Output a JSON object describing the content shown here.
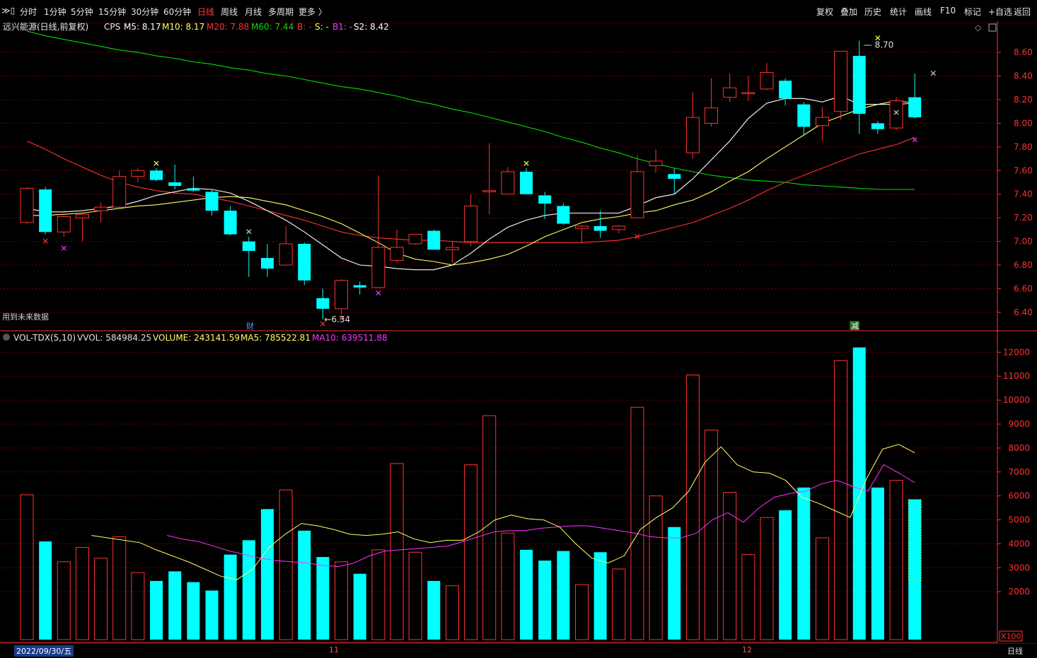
{
  "toolbar": {
    "left_items": [
      "分时",
      "1分钟",
      "5分钟",
      "15分钟",
      "30分钟",
      "60分钟",
      "日线",
      "周线",
      "月线",
      "多周期",
      "更多 〉"
    ],
    "active": "日线",
    "right_items": [
      "复权",
      "叠加",
      "历史",
      "统计",
      "画线",
      "F10",
      "标记",
      "+自选",
      "返回"
    ]
  },
  "colors": {
    "up": "#ff3232",
    "down": "#00ffff",
    "ma5": "#ffffff",
    "ma10": "#ffff66",
    "ma20": "#ff3030",
    "ma60": "#00e000",
    "vol_ma5": "#ffff66",
    "vol_ma10": "#ff33ff",
    "axis": "#ff3030",
    "grid": "#7a0000"
  },
  "main_panel": {
    "title": "远兴能源(日线,前复权)",
    "indicator": "CPS",
    "legend": [
      {
        "text": "M5: 8.17",
        "color": "#ffffff"
      },
      {
        "text": "M10: 8.17",
        "color": "#ffff66"
      },
      {
        "text": "M20: 7.88",
        "color": "#ff3030"
      },
      {
        "text": "M60: 7.44",
        "color": "#00e000"
      },
      {
        "text": "B: -",
        "color": "#ff3030"
      },
      {
        "text": "S: -",
        "color": "#ffff66"
      },
      {
        "text": "B1: -",
        "color": "#ff33ff"
      },
      {
        "text": "S2: 8.42",
        "color": "#ffffff"
      }
    ],
    "note": "用到未来数据",
    "high_label": "8.70",
    "low_label": "6.34",
    "event_markers": [
      "财",
      "减"
    ]
  },
  "vol_panel": {
    "title": "VOL-TDX(5,10)",
    "legend": [
      {
        "text": "VVOL: 584984.25",
        "color": "#e0e0e0"
      },
      {
        "text": "VOLUME: 243141.59",
        "color": "#ffff66"
      },
      {
        "text": "MA5: 785522.81",
        "color": "#ffff66"
      },
      {
        "text": "MA10: 639511.88",
        "color": "#ff33ff"
      }
    ],
    "unit": "X100"
  },
  "chart_data": {
    "type": "candlestick",
    "price_axis": {
      "ylim": [
        6.25,
        8.78
      ],
      "ticks": [
        6.4,
        6.6,
        6.8,
        7.0,
        7.2,
        7.4,
        7.6,
        7.8,
        8.0,
        8.2,
        8.4,
        8.6
      ]
    },
    "volume_axis": {
      "ylim": [
        0,
        12600
      ],
      "ticks": [
        2000,
        3000,
        4000,
        5000,
        6000,
        7000,
        8000,
        9000,
        10000,
        11000,
        12000
      ]
    },
    "x_labels": [
      "2022/09/30/五",
      "11",
      "12"
    ],
    "candles": [
      {
        "o": 7.16,
        "h": 7.46,
        "l": 7.15,
        "c": 7.45
      },
      {
        "o": 7.44,
        "h": 7.46,
        "l": 7.06,
        "c": 7.08
      },
      {
        "o": 7.08,
        "h": 7.22,
        "l": 7.04,
        "c": 7.21
      },
      {
        "o": 7.2,
        "h": 7.25,
        "l": 7.0,
        "c": 7.23
      },
      {
        "o": 7.26,
        "h": 7.33,
        "l": 7.16,
        "c": 7.29
      },
      {
        "o": 7.29,
        "h": 7.6,
        "l": 7.28,
        "c": 7.55
      },
      {
        "o": 7.55,
        "h": 7.62,
        "l": 7.5,
        "c": 7.6
      },
      {
        "o": 7.6,
        "h": 7.62,
        "l": 7.51,
        "c": 7.52
      },
      {
        "o": 7.5,
        "h": 7.65,
        "l": 7.44,
        "c": 7.47
      },
      {
        "o": 7.45,
        "h": 7.55,
        "l": 7.42,
        "c": 7.43
      },
      {
        "o": 7.42,
        "h": 7.44,
        "l": 7.22,
        "c": 7.26
      },
      {
        "o": 7.26,
        "h": 7.3,
        "l": 7.05,
        "c": 7.06
      },
      {
        "o": 7.0,
        "h": 7.04,
        "l": 6.7,
        "c": 6.92
      },
      {
        "o": 6.86,
        "h": 6.98,
        "l": 6.7,
        "c": 6.77
      },
      {
        "o": 6.8,
        "h": 7.13,
        "l": 6.8,
        "c": 6.98
      },
      {
        "o": 6.98,
        "h": 6.99,
        "l": 6.63,
        "c": 6.67
      },
      {
        "o": 6.52,
        "h": 6.6,
        "l": 6.34,
        "c": 6.43
      },
      {
        "o": 6.43,
        "h": 6.68,
        "l": 6.38,
        "c": 6.67
      },
      {
        "o": 6.63,
        "h": 6.66,
        "l": 6.55,
        "c": 6.61
      },
      {
        "o": 6.61,
        "h": 7.56,
        "l": 6.61,
        "c": 6.95
      },
      {
        "o": 6.84,
        "h": 7.1,
        "l": 6.82,
        "c": 6.95
      },
      {
        "o": 6.98,
        "h": 7.05,
        "l": 6.97,
        "c": 7.06
      },
      {
        "o": 7.09,
        "h": 7.1,
        "l": 6.93,
        "c": 6.93
      },
      {
        "o": 6.93,
        "h": 7.0,
        "l": 6.82,
        "c": 6.95
      },
      {
        "o": 7.0,
        "h": 7.4,
        "l": 6.96,
        "c": 7.3
      },
      {
        "o": 7.42,
        "h": 7.83,
        "l": 7.23,
        "c": 7.43
      },
      {
        "o": 7.4,
        "h": 7.63,
        "l": 7.4,
        "c": 7.59
      },
      {
        "o": 7.59,
        "h": 7.62,
        "l": 7.4,
        "c": 7.4
      },
      {
        "o": 7.39,
        "h": 7.42,
        "l": 7.19,
        "c": 7.32
      },
      {
        "o": 7.3,
        "h": 7.32,
        "l": 7.14,
        "c": 7.15
      },
      {
        "o": 7.11,
        "h": 7.14,
        "l": 6.99,
        "c": 7.13
      },
      {
        "o": 7.13,
        "h": 7.26,
        "l": 7.03,
        "c": 7.09
      },
      {
        "o": 7.1,
        "h": 7.14,
        "l": 7.07,
        "c": 7.13
      },
      {
        "o": 7.2,
        "h": 7.73,
        "l": 7.2,
        "c": 7.59
      },
      {
        "o": 7.64,
        "h": 7.78,
        "l": 7.58,
        "c": 7.68
      },
      {
        "o": 7.57,
        "h": 7.62,
        "l": 7.4,
        "c": 7.53
      },
      {
        "o": 7.75,
        "h": 8.26,
        "l": 7.7,
        "c": 8.05
      },
      {
        "o": 8.0,
        "h": 8.38,
        "l": 7.97,
        "c": 8.13
      },
      {
        "o": 8.22,
        "h": 8.42,
        "l": 8.18,
        "c": 8.3
      },
      {
        "o": 8.25,
        "h": 8.4,
        "l": 8.19,
        "c": 8.26
      },
      {
        "o": 8.29,
        "h": 8.51,
        "l": 8.28,
        "c": 8.43
      },
      {
        "o": 8.36,
        "h": 8.38,
        "l": 8.15,
        "c": 8.21
      },
      {
        "o": 8.16,
        "h": 8.18,
        "l": 7.9,
        "c": 7.97
      },
      {
        "o": 7.98,
        "h": 8.14,
        "l": 7.85,
        "c": 8.05
      },
      {
        "o": 8.1,
        "h": 8.61,
        "l": 8.03,
        "c": 8.61
      },
      {
        "o": 8.57,
        "h": 8.7,
        "l": 7.91,
        "c": 8.08
      },
      {
        "o": 8.0,
        "h": 8.02,
        "l": 7.91,
        "c": 7.95
      },
      {
        "o": 7.96,
        "h": 8.22,
        "l": 7.94,
        "c": 8.19
      },
      {
        "o": 8.22,
        "h": 8.42,
        "l": 8.04,
        "c": 8.05
      }
    ],
    "volume": [
      6050,
      4100,
      3250,
      3850,
      3400,
      4300,
      2800,
      2450,
      2850,
      2400,
      2050,
      3550,
      4150,
      5450,
      6250,
      4550,
      3450,
      3250,
      2750,
      3750,
      7350,
      3650,
      2450,
      2250,
      7300,
      9350,
      4450,
      3750,
      3300,
      3700,
      2300,
      3650,
      2950,
      9700,
      6000,
      4700,
      11050,
      8750,
      6150,
      3550,
      5100,
      5400,
      6350,
      4250,
      11650,
      12200,
      6350,
      6650,
      5850
    ],
    "series": [
      {
        "name": "M5",
        "values": [
          7.28,
          7.25,
          7.25,
          7.26,
          7.28,
          7.3,
          7.34,
          7.39,
          7.42,
          7.45,
          7.44,
          7.41,
          7.34,
          7.26,
          7.18,
          7.08,
          6.97,
          6.86,
          6.8,
          6.79,
          6.77,
          6.76,
          6.76,
          6.8,
          6.9,
          7.02,
          7.12,
          7.18,
          7.22,
          7.24,
          7.24,
          7.24,
          7.24,
          7.3,
          7.37,
          7.4,
          7.53,
          7.69,
          7.85,
          8.04,
          8.17,
          8.21,
          8.21,
          8.18,
          8.23,
          8.16,
          8.16,
          8.16,
          8.17
        ]
      },
      {
        "name": "M10",
        "values": [
          7.22,
          7.22,
          7.23,
          7.24,
          7.26,
          7.28,
          7.3,
          7.31,
          7.33,
          7.35,
          7.37,
          7.38,
          7.37,
          7.34,
          7.31,
          7.26,
          7.21,
          7.15,
          7.07,
          6.99,
          6.9,
          6.85,
          6.83,
          6.8,
          6.82,
          6.85,
          6.89,
          6.96,
          7.04,
          7.1,
          7.16,
          7.19,
          7.21,
          7.24,
          7.26,
          7.31,
          7.35,
          7.42,
          7.51,
          7.59,
          7.7,
          7.8,
          7.9,
          8.0,
          8.06,
          8.12,
          8.16,
          8.19,
          8.17
        ]
      },
      {
        "name": "M20",
        "values": [
          7.85,
          7.78,
          7.7,
          7.63,
          7.56,
          7.5,
          7.46,
          7.43,
          7.41,
          7.4,
          7.37,
          7.34,
          7.3,
          7.26,
          7.22,
          7.18,
          7.13,
          7.08,
          7.05,
          7.03,
          7.02,
          7.01,
          7.01,
          7.0,
          6.99,
          6.99,
          6.99,
          6.99,
          6.99,
          6.99,
          6.99,
          7.0,
          7.01,
          7.04,
          7.08,
          7.12,
          7.16,
          7.22,
          7.28,
          7.35,
          7.43,
          7.5,
          7.56,
          7.62,
          7.68,
          7.74,
          7.78,
          7.82,
          7.88
        ]
      },
      {
        "name": "M60",
        "values": [
          8.78,
          8.74,
          8.71,
          8.68,
          8.65,
          8.62,
          8.6,
          8.57,
          8.55,
          8.52,
          8.5,
          8.47,
          8.45,
          8.42,
          8.4,
          8.37,
          8.34,
          8.31,
          8.29,
          8.26,
          8.23,
          8.19,
          8.16,
          8.12,
          8.09,
          8.05,
          8.01,
          7.97,
          7.93,
          7.88,
          7.84,
          7.79,
          7.75,
          7.7,
          7.66,
          7.62,
          7.59,
          7.56,
          7.54,
          7.52,
          7.51,
          7.5,
          7.48,
          7.47,
          7.46,
          7.45,
          7.44,
          7.44,
          7.44
        ]
      },
      {
        "name": "MA5",
        "values": [
          null,
          null,
          null,
          null,
          4350,
          4250,
          4150,
          4050,
          3750,
          3500,
          3250,
          2950,
          2650,
          2500,
          2950,
          3850,
          4400,
          4850,
          4750,
          4600,
          4400,
          4350,
          4400,
          4500,
          4200,
          4050,
          4150,
          4150,
          4500,
          5000,
          5200,
          5050,
          5000,
          4700,
          4000,
          3400,
          3200,
          3500,
          4600,
          5100,
          5500,
          6200,
          7400,
          8050,
          7300,
          7000,
          6950,
          6650,
          5950,
          5700,
          5400,
          5100,
          6700,
          7950,
          8150,
          7800
        ]
      },
      {
        "name": "MA10",
        "values": [
          null,
          null,
          null,
          null,
          null,
          null,
          null,
          null,
          null,
          4350,
          4200,
          4100,
          3900,
          3700,
          3550,
          3400,
          3300,
          3250,
          3200,
          3100,
          3050,
          3200,
          3500,
          3700,
          3750,
          3800,
          3850,
          3900,
          4100,
          4300,
          4500,
          4550,
          4550,
          4650,
          4700,
          4750,
          4750,
          4650,
          4550,
          4450,
          4300,
          4250,
          4250,
          4450,
          5000,
          5300,
          4900,
          5500,
          5950,
          6100,
          6200,
          6500,
          6650,
          6400,
          6200,
          7300,
          6950,
          6550
        ]
      }
    ]
  }
}
